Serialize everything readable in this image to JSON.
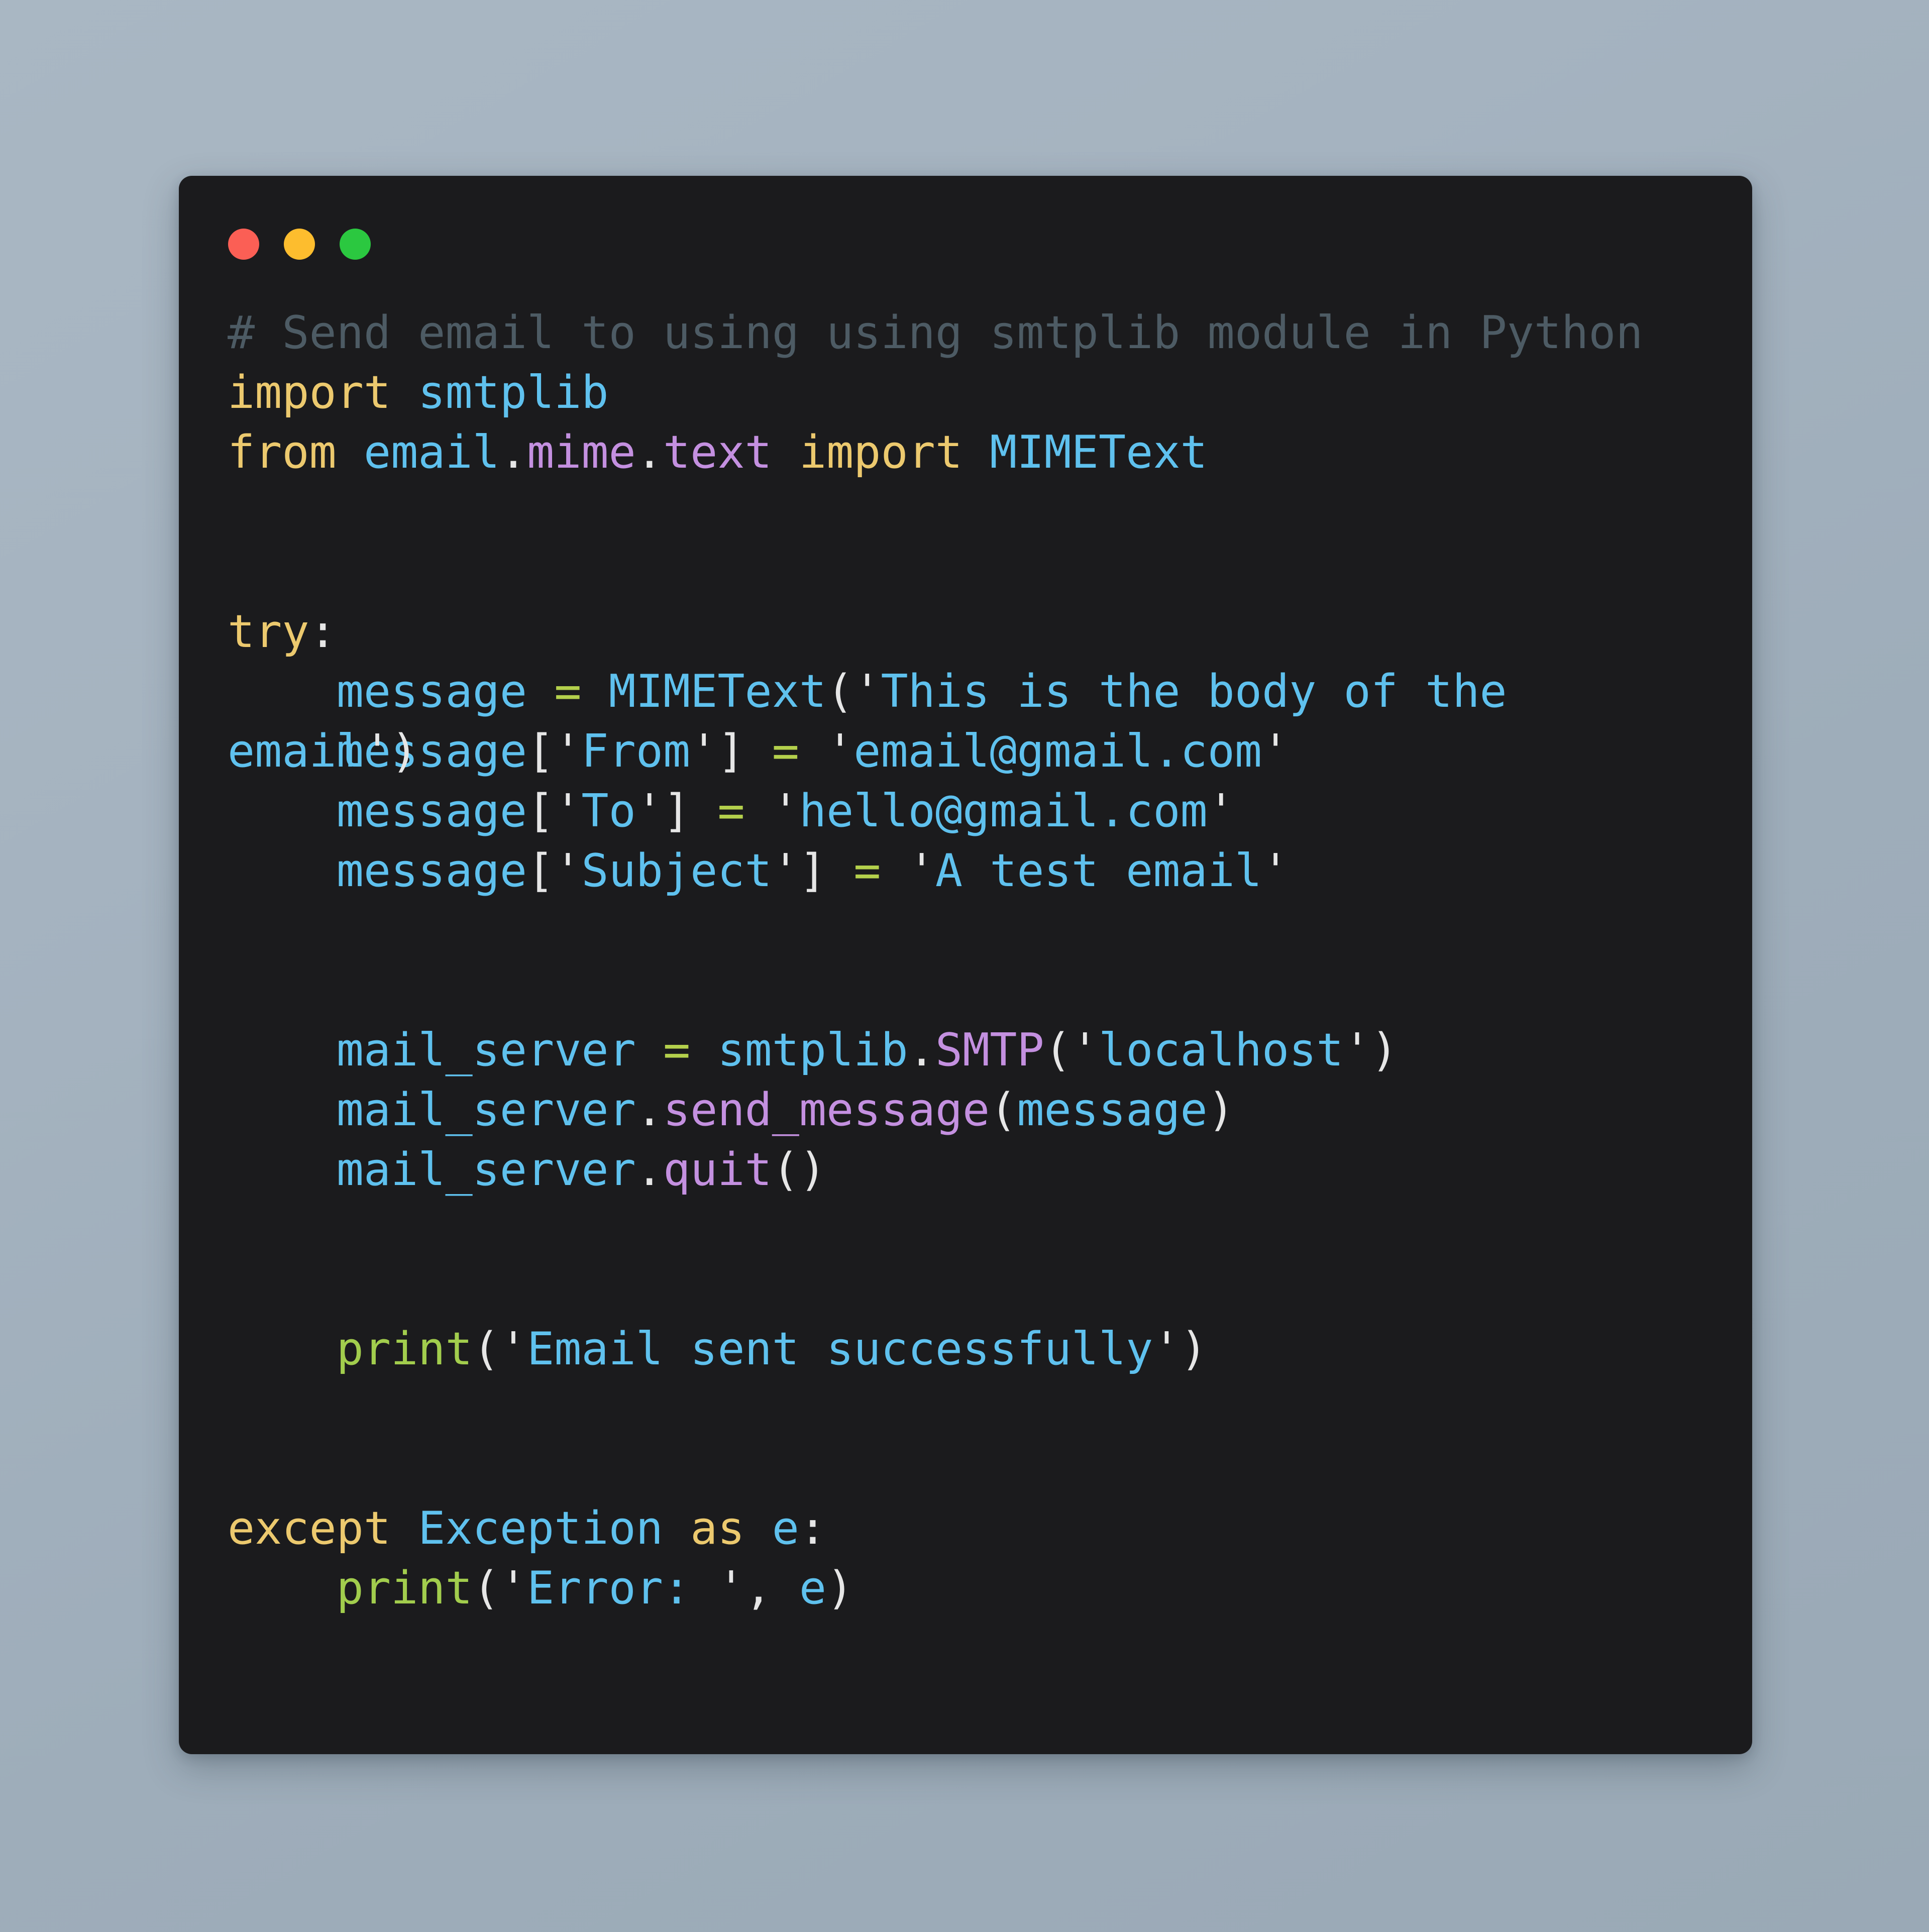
{
  "window": {
    "controls": [
      {
        "name": "close",
        "color": "#fb5f55"
      },
      {
        "name": "minimize",
        "color": "#fdbd2e"
      },
      {
        "name": "maximize",
        "color": "#2bc840"
      }
    ]
  },
  "theme": {
    "page_background": "#a5b3c0",
    "card_background": "#1b1b1d",
    "comment": "#4d5b64",
    "keyword": "#ecc96e",
    "identifier": "#5fc1ee",
    "attribute": "#c490e0",
    "punctuation": "#e6e6e6",
    "operator": "#b4d04c",
    "function": "#a2cd4d",
    "string": "#5fc1ee"
  },
  "code": {
    "language": "Python",
    "plain_text": "# Send email to using using smtplib module in Python\nimport smtplib\nfrom email.mime.text import MIMEText\n\n\ntry:\n    message = MIMEText('This is the body of the email')\n    message['From'] = 'email@gmail.com'\n    message['To'] = 'hello@gmail.com'\n    message['Subject'] = 'A test email'\n\n\n    mail_server = smtplib.SMTP('localhost')\n    mail_server.send_message(message)\n    mail_server.quit()\n\n\n    print('Email sent successfully')\n\n\nexcept Exception as e:\n    print('Error: ', e)",
    "lines": [
      {
        "id": "l1",
        "kind": "comment",
        "text": "# Send email to using using smtplib module in Python"
      },
      {
        "id": "l2",
        "kind": "code",
        "text": "import smtplib"
      },
      {
        "id": "l3",
        "kind": "code",
        "text": "from email.mime.text import MIMEText"
      },
      {
        "id": "l4",
        "kind": "blank",
        "text": ""
      },
      {
        "id": "l5",
        "kind": "blank",
        "text": ""
      },
      {
        "id": "l6",
        "kind": "code",
        "text": "try:"
      },
      {
        "id": "l7",
        "kind": "code",
        "text": "    message = MIMEText('This is the body of the"
      },
      {
        "id": "l8",
        "kind": "overlap",
        "wrap_tail": "email')",
        "text": "    message['From'] = 'email@gmail.com'"
      },
      {
        "id": "l9",
        "kind": "code",
        "text": "    message['To'] = 'hello@gmail.com'"
      },
      {
        "id": "l10",
        "kind": "code",
        "text": "    message['Subject'] = 'A test email'"
      },
      {
        "id": "l11",
        "kind": "blank",
        "text": ""
      },
      {
        "id": "l12",
        "kind": "blank",
        "text": ""
      },
      {
        "id": "l13",
        "kind": "code",
        "text": "    mail_server = smtplib.SMTP('localhost')"
      },
      {
        "id": "l14",
        "kind": "code",
        "text": "    mail_server.send_message(message)"
      },
      {
        "id": "l15",
        "kind": "code",
        "text": "    mail_server.quit()"
      },
      {
        "id": "l16",
        "kind": "blank",
        "text": ""
      },
      {
        "id": "l17",
        "kind": "blank",
        "text": ""
      },
      {
        "id": "l18",
        "kind": "code",
        "text": "    print('Email sent successfully')"
      },
      {
        "id": "l19",
        "kind": "blank",
        "text": ""
      },
      {
        "id": "l20",
        "kind": "blank",
        "text": ""
      },
      {
        "id": "l21",
        "kind": "code",
        "text": "except Exception as e:"
      },
      {
        "id": "l22",
        "kind": "code",
        "text": "    print('Error: ', e)"
      }
    ],
    "tokens": [
      [
        {
          "t": "# Send email to using using smtplib module in Python",
          "c": "c-comment"
        }
      ],
      [
        {
          "t": "import",
          "c": "c-kw"
        },
        {
          "t": " ",
          "c": "c-punct"
        },
        {
          "t": "smtplib",
          "c": "c-name"
        }
      ],
      [
        {
          "t": "from",
          "c": "c-kw"
        },
        {
          "t": " ",
          "c": "c-punct"
        },
        {
          "t": "email",
          "c": "c-name"
        },
        {
          "t": ".",
          "c": "c-punct"
        },
        {
          "t": "mime",
          "c": "c-attr"
        },
        {
          "t": ".",
          "c": "c-punct"
        },
        {
          "t": "text",
          "c": "c-attr"
        },
        {
          "t": " ",
          "c": "c-punct"
        },
        {
          "t": "import",
          "c": "c-kw"
        },
        {
          "t": " ",
          "c": "c-punct"
        },
        {
          "t": "MIMEText",
          "c": "c-name"
        }
      ],
      [],
      [],
      [
        {
          "t": "try",
          "c": "c-kw"
        },
        {
          "t": ":",
          "c": "c-punct"
        }
      ],
      [
        {
          "t": "    ",
          "c": "c-punct"
        },
        {
          "t": "message",
          "c": "c-name"
        },
        {
          "t": " ",
          "c": "c-punct"
        },
        {
          "t": "=",
          "c": "c-op"
        },
        {
          "t": " ",
          "c": "c-punct"
        },
        {
          "t": "MIMEText",
          "c": "c-name"
        },
        {
          "t": "(",
          "c": "c-quote"
        },
        {
          "t": "'",
          "c": "c-quote"
        },
        {
          "t": "This is the body of the",
          "c": "c-str"
        }
      ],
      [
        {
          "t": "    ",
          "c": "c-punct"
        },
        {
          "t": "message",
          "c": "c-name"
        },
        {
          "t": "[",
          "c": "c-quote"
        },
        {
          "t": "'",
          "c": "c-quote"
        },
        {
          "t": "From",
          "c": "c-str"
        },
        {
          "t": "'",
          "c": "c-quote"
        },
        {
          "t": "]",
          "c": "c-quote"
        },
        {
          "t": " ",
          "c": "c-punct"
        },
        {
          "t": "=",
          "c": "c-op"
        },
        {
          "t": " ",
          "c": "c-punct"
        },
        {
          "t": "'",
          "c": "c-quote"
        },
        {
          "t": "email@gmail.com",
          "c": "c-str"
        },
        {
          "t": "'",
          "c": "c-quote"
        }
      ],
      [
        {
          "t": "    ",
          "c": "c-punct"
        },
        {
          "t": "message",
          "c": "c-name"
        },
        {
          "t": "[",
          "c": "c-quote"
        },
        {
          "t": "'",
          "c": "c-quote"
        },
        {
          "t": "To",
          "c": "c-str"
        },
        {
          "t": "'",
          "c": "c-quote"
        },
        {
          "t": "]",
          "c": "c-quote"
        },
        {
          "t": " ",
          "c": "c-punct"
        },
        {
          "t": "=",
          "c": "c-op"
        },
        {
          "t": " ",
          "c": "c-punct"
        },
        {
          "t": "'",
          "c": "c-quote"
        },
        {
          "t": "hello@gmail.com",
          "c": "c-str"
        },
        {
          "t": "'",
          "c": "c-quote"
        }
      ],
      [
        {
          "t": "    ",
          "c": "c-punct"
        },
        {
          "t": "message",
          "c": "c-name"
        },
        {
          "t": "[",
          "c": "c-quote"
        },
        {
          "t": "'",
          "c": "c-quote"
        },
        {
          "t": "Subject",
          "c": "c-str"
        },
        {
          "t": "'",
          "c": "c-quote"
        },
        {
          "t": "]",
          "c": "c-quote"
        },
        {
          "t": " ",
          "c": "c-punct"
        },
        {
          "t": "=",
          "c": "c-op"
        },
        {
          "t": " ",
          "c": "c-punct"
        },
        {
          "t": "'",
          "c": "c-quote"
        },
        {
          "t": "A test email",
          "c": "c-str"
        },
        {
          "t": "'",
          "c": "c-quote"
        }
      ],
      [],
      [],
      [
        {
          "t": "    ",
          "c": "c-punct"
        },
        {
          "t": "mail_server",
          "c": "c-name"
        },
        {
          "t": " ",
          "c": "c-punct"
        },
        {
          "t": "=",
          "c": "c-op"
        },
        {
          "t": " ",
          "c": "c-punct"
        },
        {
          "t": "smtplib",
          "c": "c-name"
        },
        {
          "t": ".",
          "c": "c-quote"
        },
        {
          "t": "SMTP",
          "c": "c-attr"
        },
        {
          "t": "(",
          "c": "c-quote"
        },
        {
          "t": "'",
          "c": "c-quote"
        },
        {
          "t": "localhost",
          "c": "c-str"
        },
        {
          "t": "'",
          "c": "c-quote"
        },
        {
          "t": ")",
          "c": "c-quote"
        }
      ],
      [
        {
          "t": "    ",
          "c": "c-punct"
        },
        {
          "t": "mail_server",
          "c": "c-name"
        },
        {
          "t": ".",
          "c": "c-quote"
        },
        {
          "t": "send_message",
          "c": "c-attr"
        },
        {
          "t": "(",
          "c": "c-quote"
        },
        {
          "t": "message",
          "c": "c-name"
        },
        {
          "t": ")",
          "c": "c-quote"
        }
      ],
      [
        {
          "t": "    ",
          "c": "c-punct"
        },
        {
          "t": "mail_server",
          "c": "c-name"
        },
        {
          "t": ".",
          "c": "c-quote"
        },
        {
          "t": "quit",
          "c": "c-attr"
        },
        {
          "t": "(",
          "c": "c-quote"
        },
        {
          "t": ")",
          "c": "c-quote"
        }
      ],
      [],
      [],
      [
        {
          "t": "    ",
          "c": "c-punct"
        },
        {
          "t": "print",
          "c": "c-func"
        },
        {
          "t": "(",
          "c": "c-quote"
        },
        {
          "t": "'",
          "c": "c-quote"
        },
        {
          "t": "Email sent successfully",
          "c": "c-str"
        },
        {
          "t": "'",
          "c": "c-quote"
        },
        {
          "t": ")",
          "c": "c-quote"
        }
      ],
      [],
      [],
      [
        {
          "t": "except",
          "c": "c-kw"
        },
        {
          "t": " ",
          "c": "c-punct"
        },
        {
          "t": "Exception",
          "c": "c-name"
        },
        {
          "t": " ",
          "c": "c-punct"
        },
        {
          "t": "as",
          "c": "c-kw"
        },
        {
          "t": " ",
          "c": "c-punct"
        },
        {
          "t": "e",
          "c": "c-name"
        },
        {
          "t": ":",
          "c": "c-punct"
        }
      ],
      [
        {
          "t": "    ",
          "c": "c-punct"
        },
        {
          "t": "print",
          "c": "c-func"
        },
        {
          "t": "(",
          "c": "c-quote"
        },
        {
          "t": "'",
          "c": "c-quote"
        },
        {
          "t": "Error: ",
          "c": "c-str"
        },
        {
          "t": "'",
          "c": "c-quote"
        },
        {
          "t": ",",
          "c": "c-quote"
        },
        {
          "t": " ",
          "c": "c-punct"
        },
        {
          "t": "e",
          "c": "c-name"
        },
        {
          "t": ")",
          "c": "c-quote"
        }
      ]
    ],
    "wrap_tails": {
      "l8": [
        {
          "t": "email",
          "c": "c-str"
        },
        {
          "t": "'",
          "c": "c-quote"
        },
        {
          "t": ")",
          "c": "c-quote"
        }
      ]
    }
  }
}
